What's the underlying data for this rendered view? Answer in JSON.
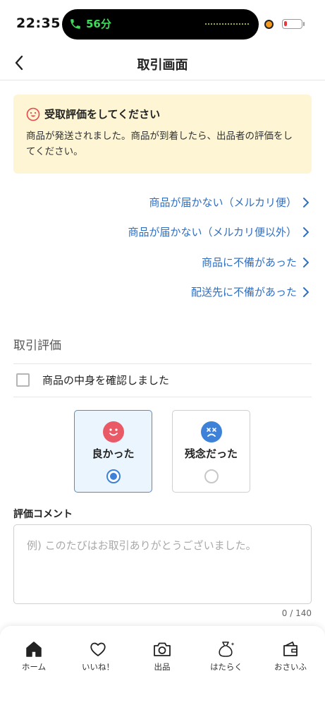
{
  "status_bar": {
    "time": "22:35",
    "call_duration": "56分",
    "battery_level": 0.2,
    "accent_call": "#3ddc5a",
    "accent_battery": "#e5393b"
  },
  "header": {
    "title": "取引画面",
    "back_icon": "chevron-left-icon"
  },
  "notice": {
    "icon": "smiley-icon",
    "title": "受取評価をしてください",
    "body": "商品が発送されました。商品が到着したら、出品者の評価をしてください。",
    "background": "#fdf5d3"
  },
  "links": [
    {
      "label": "商品が届かない（メルカリ便）"
    },
    {
      "label": "商品が届かない（メルカリ便以外）"
    },
    {
      "label": "商品に不備があった"
    },
    {
      "label": "配送先に不備があった"
    }
  ],
  "review": {
    "section_title": "取引評価",
    "confirm_checkbox_label": "商品の中身を確認しました",
    "confirm_checked": false,
    "options": [
      {
        "label": "良かった",
        "icon": "happy-face-icon",
        "selected": true
      },
      {
        "label": "残念だった",
        "icon": "sad-face-icon",
        "selected": false
      }
    ],
    "comment_label": "評価コメント",
    "comment_value": "",
    "comment_placeholder": "例) このたびはお取引ありがとうございました。",
    "comment_counter": "0 / 140"
  },
  "tabs": [
    {
      "label": "ホーム",
      "icon": "home-icon"
    },
    {
      "label": "いいね！",
      "icon": "heart-icon"
    },
    {
      "label": "出品",
      "icon": "camera-icon"
    },
    {
      "label": "はたらく",
      "icon": "money-bag-icon"
    },
    {
      "label": "おさいふ",
      "icon": "wallet-icon"
    }
  ],
  "colors": {
    "link": "#2f6fc2",
    "selected": "#3d82d8",
    "happy_face": "#ea5a66",
    "sad_face": "#3d82d8"
  }
}
